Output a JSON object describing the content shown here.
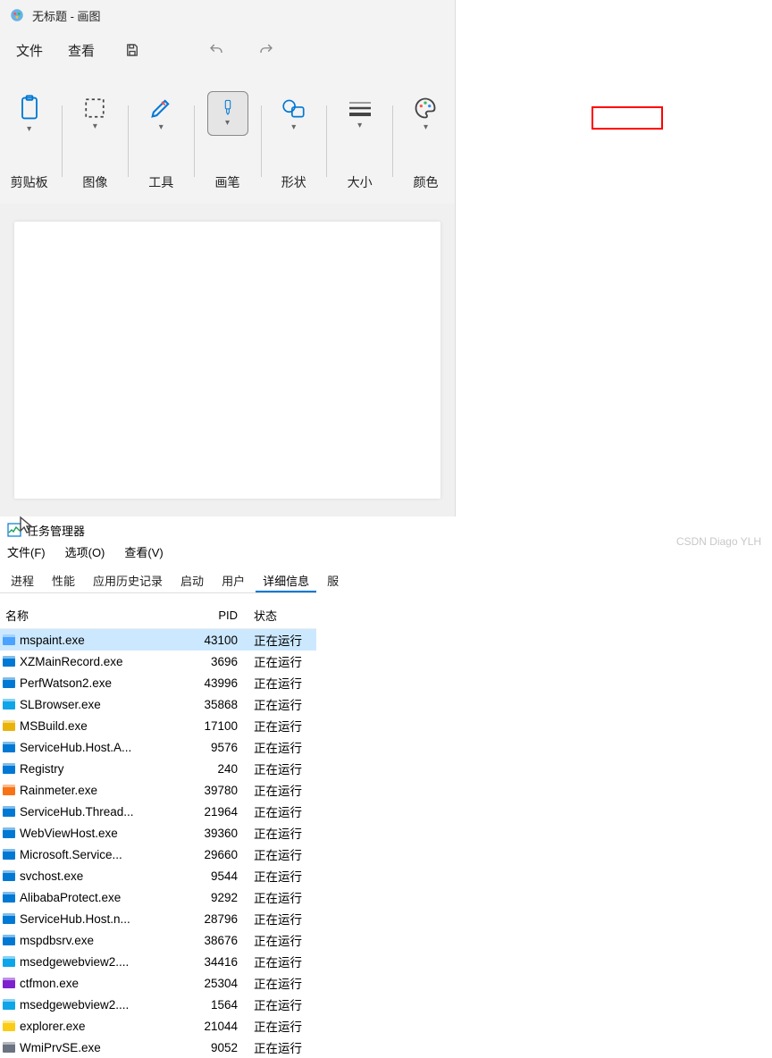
{
  "paint": {
    "title": "无标题 - 画图",
    "menu": {
      "file": "文件",
      "view": "查看"
    },
    "ribbon": {
      "clipboard": "剪贴板",
      "image": "图像",
      "tools": "工具",
      "brushes": "画笔",
      "shapes": "形状",
      "size": "大小",
      "colors": "颜色"
    }
  },
  "tm": {
    "title": "任务管理器",
    "menu": {
      "file": "文件(F)",
      "options": "选项(O)",
      "view": "查看(V)"
    },
    "tabs": {
      "processes": "进程",
      "performance": "性能",
      "app_history": "应用历史记录",
      "startup": "启动",
      "users": "用户",
      "details": "详细信息",
      "services": "服"
    },
    "headers": {
      "name": "名称",
      "pid": "PID",
      "status": "状态"
    },
    "processes": [
      {
        "name": "mspaint.exe",
        "pid": "43100",
        "status": "正在运行",
        "selected": true,
        "iconColor": "#4aa3ff"
      },
      {
        "name": "XZMainRecord.exe",
        "pid": "3696",
        "status": "正在运行",
        "iconColor": "#0078d4"
      },
      {
        "name": "PerfWatson2.exe",
        "pid": "43996",
        "status": "正在运行",
        "iconColor": "#0078d4"
      },
      {
        "name": "SLBrowser.exe",
        "pid": "35868",
        "status": "正在运行",
        "iconColor": "#0ea5e9"
      },
      {
        "name": "MSBuild.exe",
        "pid": "17100",
        "status": "正在运行",
        "iconColor": "#eab308"
      },
      {
        "name": "ServiceHub.Host.A...",
        "pid": "9576",
        "status": "正在运行",
        "iconColor": "#0078d4"
      },
      {
        "name": "Registry",
        "pid": "240",
        "status": "正在运行",
        "iconColor": "#0078d4"
      },
      {
        "name": "Rainmeter.exe",
        "pid": "39780",
        "status": "正在运行",
        "iconColor": "#f97316"
      },
      {
        "name": "ServiceHub.Thread...",
        "pid": "21964",
        "status": "正在运行",
        "iconColor": "#0078d4"
      },
      {
        "name": "WebViewHost.exe",
        "pid": "39360",
        "status": "正在运行",
        "iconColor": "#0078d4"
      },
      {
        "name": "Microsoft.Service...",
        "pid": "29660",
        "status": "正在运行",
        "iconColor": "#0078d4"
      },
      {
        "name": "svchost.exe",
        "pid": "9544",
        "status": "正在运行",
        "iconColor": "#0078d4"
      },
      {
        "name": "AlibabaProtect.exe",
        "pid": "9292",
        "status": "正在运行",
        "iconColor": "#0078d4"
      },
      {
        "name": "ServiceHub.Host.n...",
        "pid": "28796",
        "status": "正在运行",
        "iconColor": "#0078d4"
      },
      {
        "name": "mspdbsrv.exe",
        "pid": "38676",
        "status": "正在运行",
        "iconColor": "#0078d4"
      },
      {
        "name": "msedgewebview2....",
        "pid": "34416",
        "status": "正在运行",
        "iconColor": "#0ea5e9"
      },
      {
        "name": "ctfmon.exe",
        "pid": "25304",
        "status": "正在运行",
        "iconColor": "#7e22ce"
      },
      {
        "name": "msedgewebview2....",
        "pid": "1564",
        "status": "正在运行",
        "iconColor": "#0ea5e9"
      },
      {
        "name": "explorer.exe",
        "pid": "21044",
        "status": "正在运行",
        "iconColor": "#facc15"
      },
      {
        "name": "WmiPrvSE.exe",
        "pid": "9052",
        "status": "正在运行",
        "iconColor": "#6b7280"
      }
    ]
  },
  "watermark": "CSDN Diago YLH"
}
